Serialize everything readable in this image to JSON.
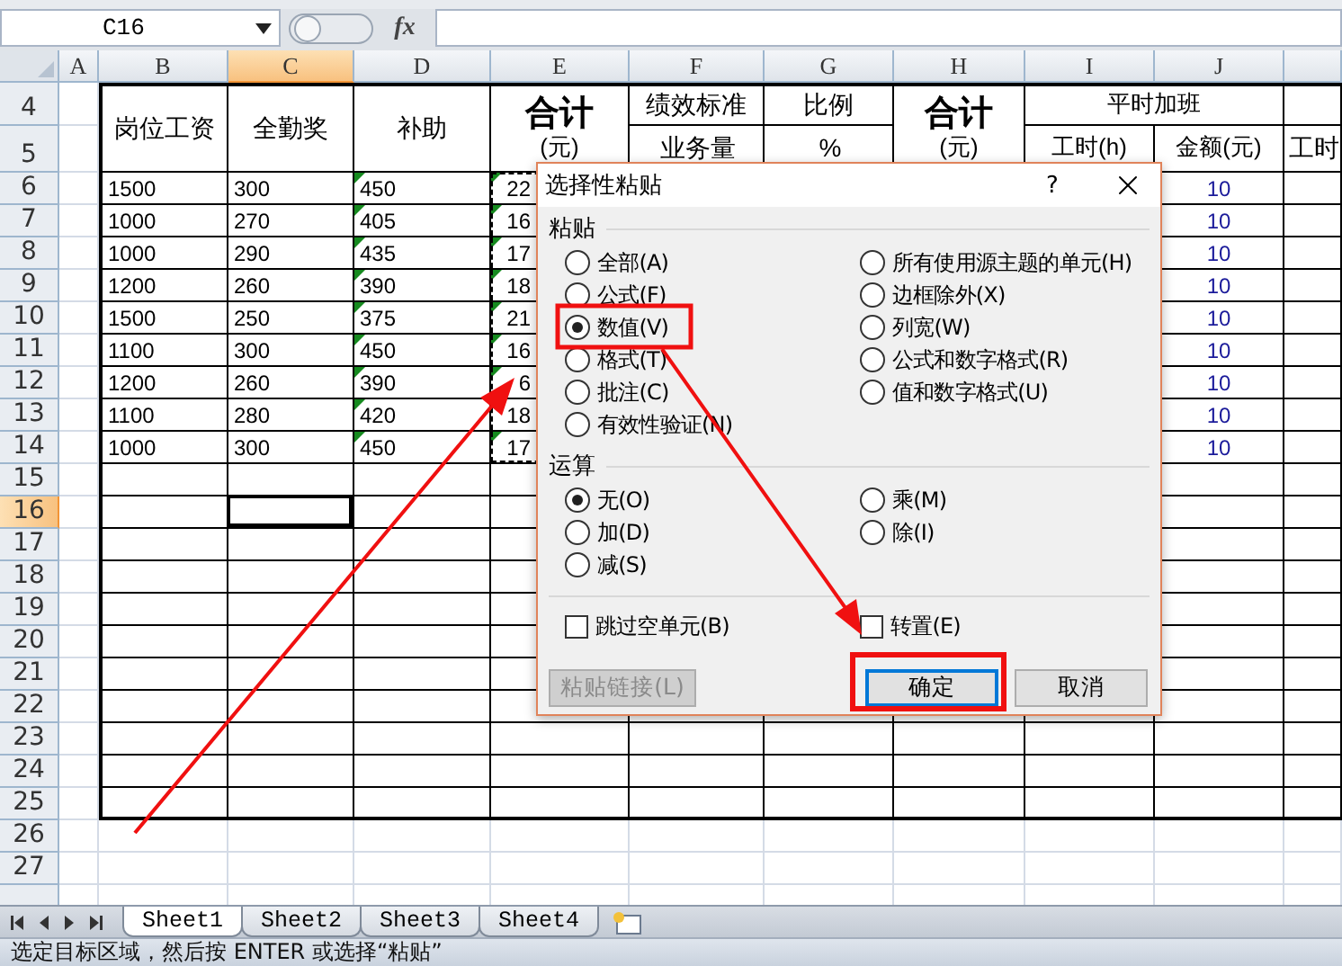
{
  "name_box": "C16",
  "function_symbol": "fx",
  "columns": [
    {
      "label": "A",
      "selected": false
    },
    {
      "label": "B",
      "selected": false
    },
    {
      "label": "C",
      "selected": true
    },
    {
      "label": "D",
      "selected": false
    },
    {
      "label": "E",
      "selected": false
    },
    {
      "label": "F",
      "selected": false
    },
    {
      "label": "G",
      "selected": false
    },
    {
      "label": "H",
      "selected": false
    },
    {
      "label": "I",
      "selected": false
    },
    {
      "label": "J",
      "selected": false
    }
  ],
  "header_rows": [
    "4",
    "5"
  ],
  "header": [
    {
      "kind": "tall",
      "text": "岗位工资"
    },
    {
      "kind": "tall",
      "text": "全勤奖"
    },
    {
      "kind": "tall",
      "text": "补助"
    },
    {
      "kind": "total",
      "text": "合计",
      "unit": "(元)"
    },
    {
      "kind": "split",
      "top": "绩效标准",
      "bottom": "业务量"
    },
    {
      "kind": "split",
      "top": "比例",
      "bottom": "%"
    },
    {
      "kind": "total",
      "text": "合计",
      "unit": "(元)"
    },
    {
      "kind": "group",
      "top": "平时加班",
      "subs": [
        "工时(h)",
        "金额(元)"
      ]
    },
    {
      "kind": "split",
      "bottom": "工时"
    }
  ],
  "rows": [
    {
      "number": "6",
      "kind": "table",
      "selected": false,
      "flagged": true,
      "copied": true,
      "values": [
        "1500",
        "300",
        "450",
        "22",
        "10"
      ]
    },
    {
      "number": "7",
      "kind": "table",
      "selected": false,
      "flagged": true,
      "copied": true,
      "values": [
        "1000",
        "270",
        "405",
        "16",
        "10"
      ]
    },
    {
      "number": "8",
      "kind": "table",
      "selected": false,
      "flagged": true,
      "copied": true,
      "values": [
        "1000",
        "290",
        "435",
        "17",
        "10"
      ]
    },
    {
      "number": "9",
      "kind": "table",
      "selected": false,
      "flagged": true,
      "copied": true,
      "values": [
        "1200",
        "260",
        "390",
        "18",
        "10"
      ]
    },
    {
      "number": "10",
      "kind": "table",
      "selected": false,
      "flagged": true,
      "copied": true,
      "values": [
        "1500",
        "250",
        "375",
        "21",
        "10"
      ]
    },
    {
      "number": "11",
      "kind": "table",
      "selected": false,
      "flagged": true,
      "copied": true,
      "values": [
        "1100",
        "300",
        "450",
        "16",
        "10"
      ]
    },
    {
      "number": "12",
      "kind": "table",
      "selected": false,
      "flagged": true,
      "copied": true,
      "values": [
        "1200",
        "260",
        "390",
        "6",
        "10"
      ]
    },
    {
      "number": "13",
      "kind": "table",
      "selected": false,
      "flagged": true,
      "copied": true,
      "values": [
        "1100",
        "280",
        "420",
        "18",
        "10"
      ]
    },
    {
      "number": "14",
      "kind": "table",
      "selected": false,
      "flagged": true,
      "copied": true,
      "values": [
        "1000",
        "300",
        "450",
        "17",
        "10"
      ]
    },
    {
      "number": "15",
      "kind": "table",
      "selected": false,
      "flagged": false,
      "copied": false
    },
    {
      "number": "16",
      "kind": "table",
      "selected": true,
      "flagged": false,
      "copied": false
    },
    {
      "number": "17",
      "kind": "table",
      "selected": false,
      "flagged": false,
      "copied": false
    },
    {
      "number": "18",
      "kind": "table",
      "selected": false,
      "flagged": false,
      "copied": false
    },
    {
      "number": "19",
      "kind": "table",
      "selected": false,
      "flagged": false,
      "copied": false
    },
    {
      "number": "20",
      "kind": "table",
      "selected": false,
      "flagged": false,
      "copied": false
    },
    {
      "number": "21",
      "kind": "table",
      "selected": false,
      "flagged": false,
      "copied": false
    },
    {
      "number": "22",
      "kind": "table",
      "selected": false,
      "flagged": false,
      "copied": false
    },
    {
      "number": "23",
      "kind": "table",
      "selected": false,
      "flagged": false,
      "copied": false
    },
    {
      "number": "24",
      "kind": "table",
      "selected": false,
      "flagged": false,
      "copied": false
    },
    {
      "number": "25",
      "kind": "table",
      "selected": false,
      "flagged": false,
      "copied": false
    },
    {
      "number": "26",
      "kind": "sheet",
      "selected": false,
      "flagged": false,
      "copied": false
    },
    {
      "number": "27",
      "kind": "sheet",
      "selected": false,
      "flagged": false,
      "copied": false
    }
  ],
  "dialog": {
    "title": "选择性粘贴",
    "help": "?",
    "paste_label": "粘贴",
    "paste_options": [
      {
        "label": "全部(A)",
        "selected": false
      },
      {
        "label": "公式(F)",
        "selected": false
      },
      {
        "label": "数值(V)",
        "selected": true
      },
      {
        "label": "格式(T)",
        "selected": false
      },
      {
        "label": "批注(C)",
        "selected": false
      },
      {
        "label": "有效性验证(N)",
        "selected": false
      },
      {
        "label": "所有使用源主题的单元(H)",
        "selected": false
      },
      {
        "label": "边框除外(X)",
        "selected": false
      },
      {
        "label": "列宽(W)",
        "selected": false
      },
      {
        "label": "公式和数字格式(R)",
        "selected": false
      },
      {
        "label": "值和数字格式(U)",
        "selected": false
      }
    ],
    "operation_label": "运算",
    "operation_options": [
      {
        "label": "无(O)",
        "selected": true
      },
      {
        "label": "加(D)",
        "selected": false
      },
      {
        "label": "减(S)",
        "selected": false
      },
      {
        "label": "乘(M)",
        "selected": false
      },
      {
        "label": "除(I)",
        "selected": false
      }
    ],
    "checkboxes": [
      {
        "label": "跳过空单元(B)",
        "checked": false
      },
      {
        "label": "转置(E)",
        "checked": false
      }
    ],
    "buttons": [
      {
        "label": "粘贴链接(L)",
        "kind": "link",
        "disabled": true
      },
      {
        "label": "确定",
        "kind": "primary",
        "disabled": false
      },
      {
        "label": "取消",
        "kind": "normal",
        "disabled": false
      }
    ]
  },
  "sheets": [
    {
      "label": "Sheet1",
      "selected": true
    },
    {
      "label": "Sheet2",
      "selected": false
    },
    {
      "label": "Sheet3",
      "selected": false
    },
    {
      "label": "Sheet4",
      "selected": false
    }
  ],
  "status": "选定目标区域，然后按 ENTER 或选择“粘贴”"
}
